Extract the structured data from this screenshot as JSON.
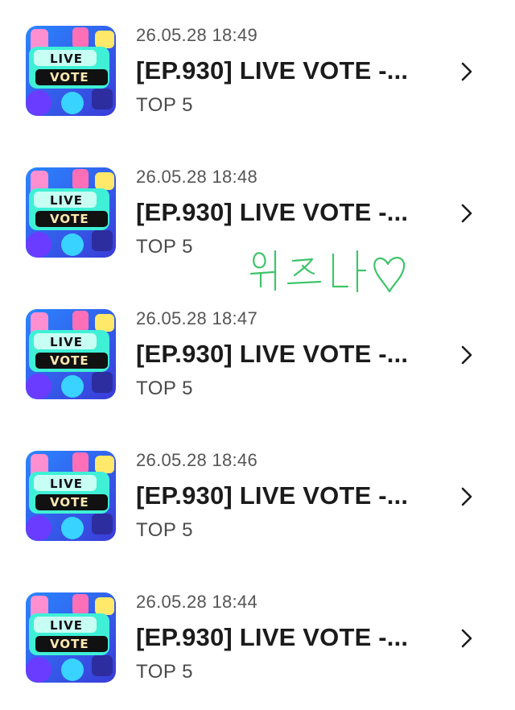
{
  "colors": {
    "title": "#1b1b1b",
    "timestamp": "#555555",
    "subtitle": "#4a4a4a",
    "chevron": "#1b1b1b",
    "scribble": "#3ec46a",
    "thumb_bg": "#1f6bff",
    "thumb_sticker": "#3ff0d6",
    "thumb_banner": "#111111"
  },
  "thumbnail": {
    "line1": "LIVE",
    "line2": "VOTE"
  },
  "items": [
    {
      "timestamp": "26.05.28 18:49",
      "title": "[EP.930] LIVE VOTE -...",
      "subtitle": "TOP 5",
      "thumbnail_icon": "live-vote-icon",
      "action_icon": "chevron-right-icon"
    },
    {
      "timestamp": "26.05.28 18:48",
      "title": "[EP.930] LIVE VOTE -...",
      "subtitle": "TOP 5",
      "thumbnail_icon": "live-vote-icon",
      "action_icon": "chevron-right-icon"
    },
    {
      "timestamp": "26.05.28 18:47",
      "title": "[EP.930] LIVE VOTE -...",
      "subtitle": "TOP 5",
      "thumbnail_icon": "live-vote-icon",
      "action_icon": "chevron-right-icon"
    },
    {
      "timestamp": "26.05.28 18:46",
      "title": "[EP.930] LIVE VOTE -...",
      "subtitle": "TOP 5",
      "thumbnail_icon": "live-vote-icon",
      "action_icon": "chevron-right-icon"
    },
    {
      "timestamp": "26.05.28 18:44",
      "title": "[EP.930] LIVE VOTE -...",
      "subtitle": "TOP 5",
      "thumbnail_icon": "live-vote-icon",
      "action_icon": "chevron-right-icon"
    }
  ],
  "annotation": {
    "text": "위즈나♡",
    "style": "handwritten"
  }
}
